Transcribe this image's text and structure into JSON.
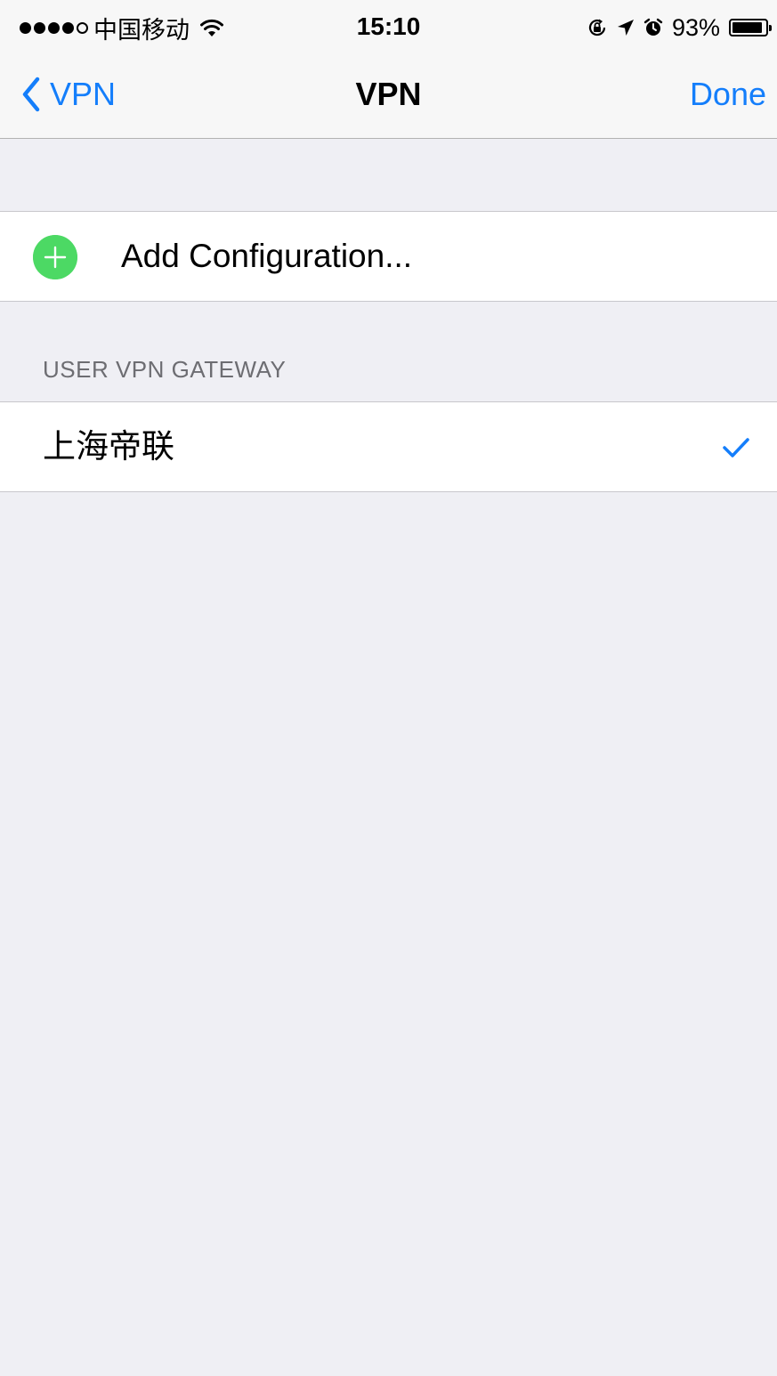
{
  "status_bar": {
    "carrier": "中国移动",
    "time": "15:10",
    "battery_percent": "93%",
    "battery_level": 0.93,
    "signal_icon": "signal-dots-icon",
    "wifi_icon": "wifi-icon",
    "lock_icon": "rotation-lock-icon",
    "location_icon": "location-arrow-icon",
    "alarm_icon": "alarm-icon"
  },
  "nav": {
    "back_label": "VPN",
    "title": "VPN",
    "done_label": "Done"
  },
  "add_configuration": {
    "label": "Add Configuration...",
    "icon": "plus-icon"
  },
  "section": {
    "header": "USER VPN GATEWAY",
    "items": [
      {
        "label": "上海帝联",
        "selected": true
      }
    ]
  },
  "colors": {
    "accent": "#147efb",
    "add_green": "#4cd964",
    "background": "#efeff4"
  }
}
